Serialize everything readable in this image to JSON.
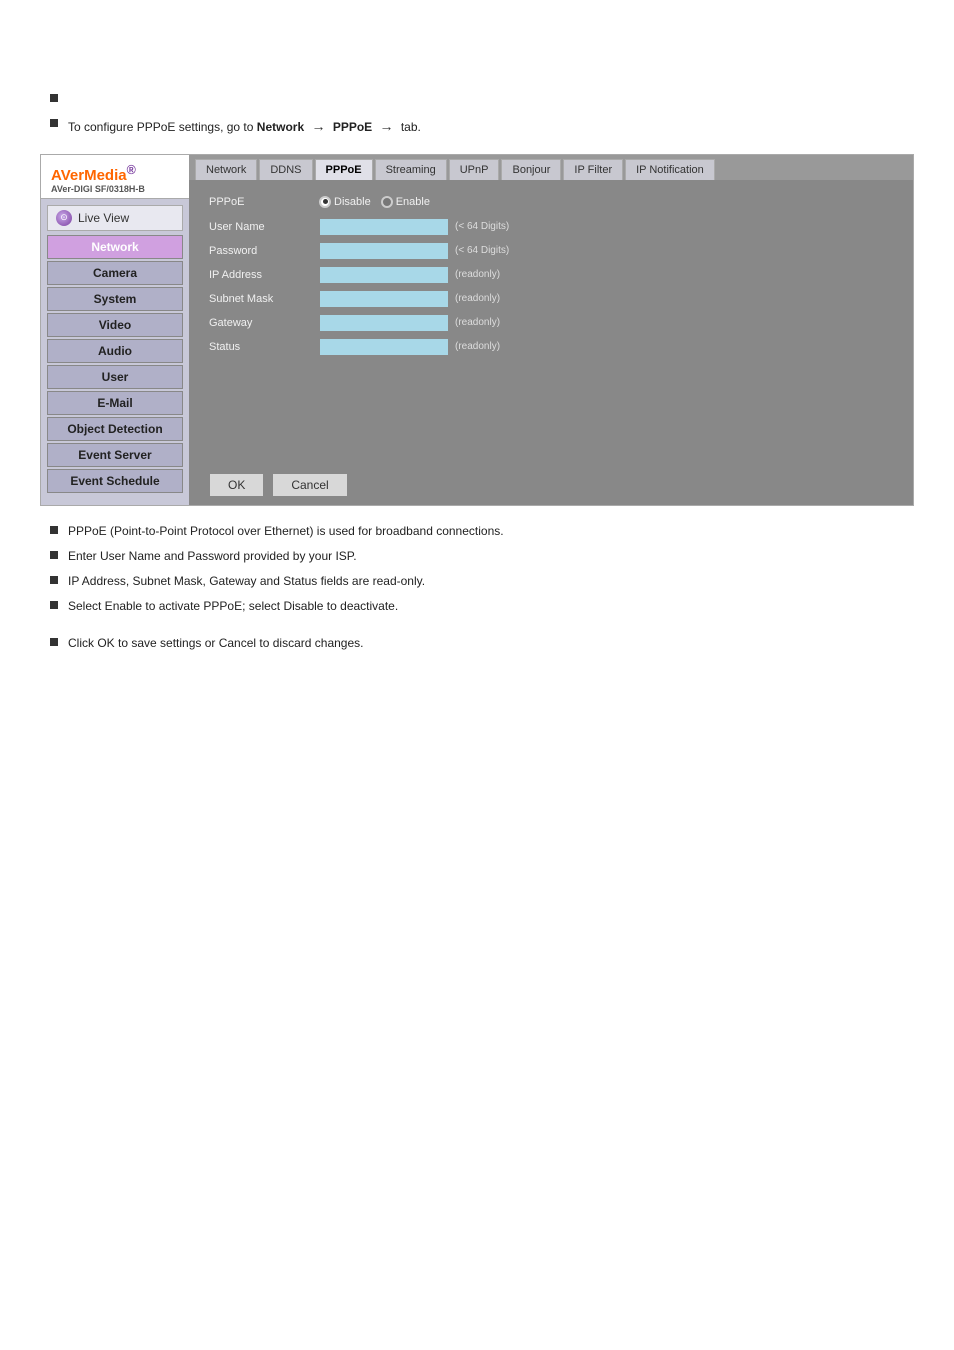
{
  "page": {
    "bullets_top": [
      "",
      "To configure PPPoE settings, go to Network → PPPoE tab."
    ],
    "logo": {
      "brand": "AVerMedia",
      "brand_accent": "®",
      "model": "AVer-DIGI SF/0318H-B"
    },
    "sidebar": {
      "live_view_label": "Live View",
      "items": [
        {
          "id": "network",
          "label": "Network",
          "active": true
        },
        {
          "id": "camera",
          "label": "Camera",
          "active": false
        },
        {
          "id": "system",
          "label": "System",
          "active": false
        },
        {
          "id": "video",
          "label": "Video",
          "active": false
        },
        {
          "id": "audio",
          "label": "Audio",
          "active": false
        },
        {
          "id": "user",
          "label": "User",
          "active": false
        },
        {
          "id": "email",
          "label": "E-Mail",
          "active": false
        },
        {
          "id": "object-detection",
          "label": "Object Detection",
          "active": false
        },
        {
          "id": "event-server",
          "label": "Event Server",
          "active": false
        },
        {
          "id": "event-schedule",
          "label": "Event Schedule",
          "active": false
        }
      ]
    },
    "tabs": [
      {
        "id": "network",
        "label": "Network"
      },
      {
        "id": "ddns",
        "label": "DDNS"
      },
      {
        "id": "pppoe",
        "label": "PPPoE",
        "active": true
      },
      {
        "id": "streaming",
        "label": "Streaming"
      },
      {
        "id": "upnp",
        "label": "UPnP"
      },
      {
        "id": "bonjour",
        "label": "Bonjour"
      },
      {
        "id": "ip-filter",
        "label": "IP Filter"
      },
      {
        "id": "ip-notification",
        "label": "IP Notification"
      }
    ],
    "form": {
      "pppoe_label": "PPPoE",
      "disable_label": "Disable",
      "enable_label": "Enable",
      "fields": [
        {
          "id": "user-name",
          "label": "User Name",
          "hint": "(< 64 Digits)",
          "readonly": false
        },
        {
          "id": "password",
          "label": "Password",
          "hint": "(< 64 Digits)",
          "readonly": false
        },
        {
          "id": "ip-address",
          "label": "IP Address",
          "hint": "(readonly)",
          "readonly": true
        },
        {
          "id": "subnet-mask",
          "label": "Subnet Mask",
          "hint": "(readonly)",
          "readonly": true
        },
        {
          "id": "gateway",
          "label": "Gateway",
          "hint": "(readonly)",
          "readonly": true
        },
        {
          "id": "status",
          "label": "Status",
          "hint": "(readonly)",
          "readonly": true
        }
      ]
    },
    "buttons": {
      "ok": "OK",
      "cancel": "Cancel"
    },
    "bullets_bottom": [
      "PPPoE (Point-to-Point Protocol over Ethernet) is used for broadband connections.",
      "Enter User Name and Password provided by your ISP.",
      "IP Address, Subnet Mask, Gateway and Status fields are read-only.",
      "Select Enable to activate PPPoE; select Disable to deactivate.",
      "Click OK to save settings or Cancel to discard changes."
    ]
  }
}
